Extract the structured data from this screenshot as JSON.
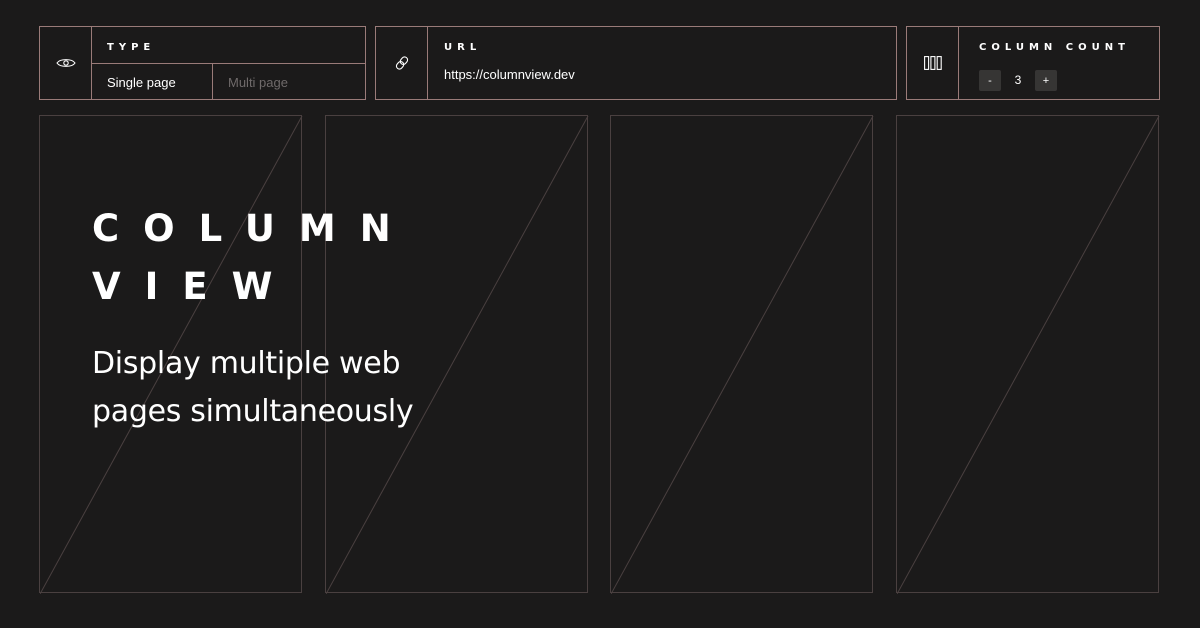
{
  "type_panel": {
    "label": "TYPE",
    "icon": "eye-icon",
    "options": [
      {
        "label": "Single page",
        "selected": true
      },
      {
        "label": "Multi page",
        "selected": false
      }
    ]
  },
  "url_panel": {
    "label": "URL",
    "icon": "link-icon",
    "value": "https://columnview.dev"
  },
  "column_count_panel": {
    "label": "COLUMN COUNT",
    "icon": "columns-icon",
    "decrement_label": "-",
    "value": "3",
    "increment_label": "+"
  },
  "hero": {
    "title_line1": "COLUMN",
    "title_line2": "VIEW",
    "subtitle_line1": "Display multiple web",
    "subtitle_line2": "pages simultaneously"
  },
  "colors": {
    "background": "#1b1a1a",
    "panel_border": "#9a7b79",
    "column_border": "#4a4040",
    "text": "#ffffff",
    "muted_text": "#6f6a6a",
    "button_bg": "#363534"
  }
}
